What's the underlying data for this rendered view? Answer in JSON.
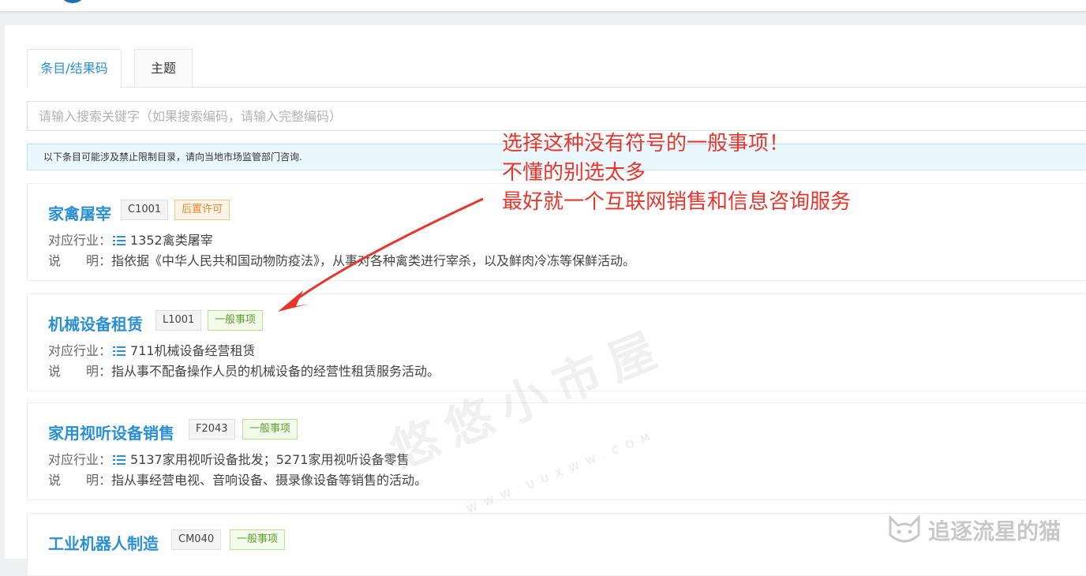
{
  "tabs": [
    {
      "label": "条目/结果码"
    },
    {
      "label": "主题"
    }
  ],
  "search": {
    "placeholder": "请输入搜索关键字（如果搜索编码，请输入完整编码）"
  },
  "notice": "以下条目可能涉及禁止限制目录，请向当地市场监管部门咨询.",
  "labels": {
    "industry": "对应行业：",
    "description": "说　　明："
  },
  "items": [
    {
      "title": "家禽屠宰",
      "code": "C1001",
      "type": "后置许可",
      "type_color": "#e6892e",
      "industry": "1352禽类屠宰",
      "description": "指依据《中华人民共和国动物防疫法》，从事对各种禽类进行宰杀，以及鲜肉冷冻等保鲜活动。"
    },
    {
      "title": "机械设备租赁",
      "code": "L1001",
      "type": "一般事项",
      "type_color": "#5e9e2f",
      "industry": "711机械设备经营租赁",
      "description": "指从事不配备操作人员的机械设备的经营性租赁服务活动。"
    },
    {
      "title": "家用视听设备销售",
      "code": "F2043",
      "type": "一般事项",
      "type_color": "#5e9e2f",
      "industry": "5137家用视听设备批发；5271家用视听设备零售",
      "description": "指从事经营电视、音响设备、摄录像设备等销售的活动。"
    },
    {
      "title": "工业机器人制造",
      "code": "CM040",
      "type": "一般事项",
      "type_color": "#5e9e2f"
    }
  ],
  "annotation": {
    "lines": [
      "选择这种没有符号的一般事项！",
      "不懂的别选太多",
      "最好就一个互联网销售和信息咨询服务"
    ],
    "color": "#e8362c"
  },
  "watermark": {
    "main": "悠悠小市屋",
    "sub": "WWW.UUXWW.COM"
  },
  "corner_watermark": {
    "text": "追逐流星的猫",
    "icon": "cat-face-icon"
  },
  "colors": {
    "accent": "#2b8fd6",
    "orange_badge": "#e6892e",
    "green_badge": "#5e9e2f"
  }
}
